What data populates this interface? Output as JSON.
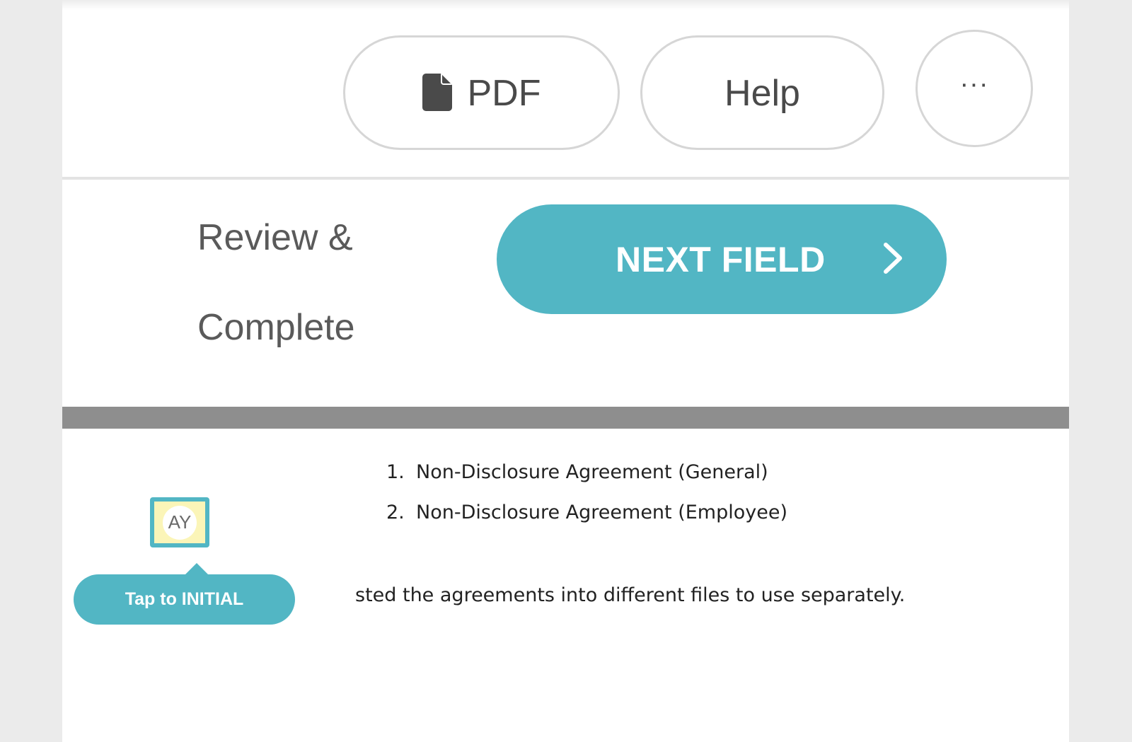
{
  "toolbar": {
    "pdf_label": "PDF",
    "help_label": "Help",
    "more_label": "···"
  },
  "header": {
    "title_line1": "Review &",
    "title_line2": "Complete",
    "next_label": "NEXT FIELD"
  },
  "document": {
    "items": [
      {
        "num": "1.",
        "text": "Non-Disclosure Agreement (General)"
      },
      {
        "num": "2.",
        "text": "Non-Disclosure Agreement (Employee)"
      }
    ],
    "body_text": "sted the agreements into different files to use separately."
  },
  "initial_field": {
    "initials": "AY",
    "tooltip": "Tap to INITIAL"
  },
  "colors": {
    "accent": "#52b6c4",
    "initial_fill": "#fbf5b8",
    "page_bg": "#ebebeb",
    "separator": "#8e8e8e"
  },
  "icons": [
    "pdf-file-icon",
    "chevron-right-icon",
    "more-options-icon"
  ]
}
